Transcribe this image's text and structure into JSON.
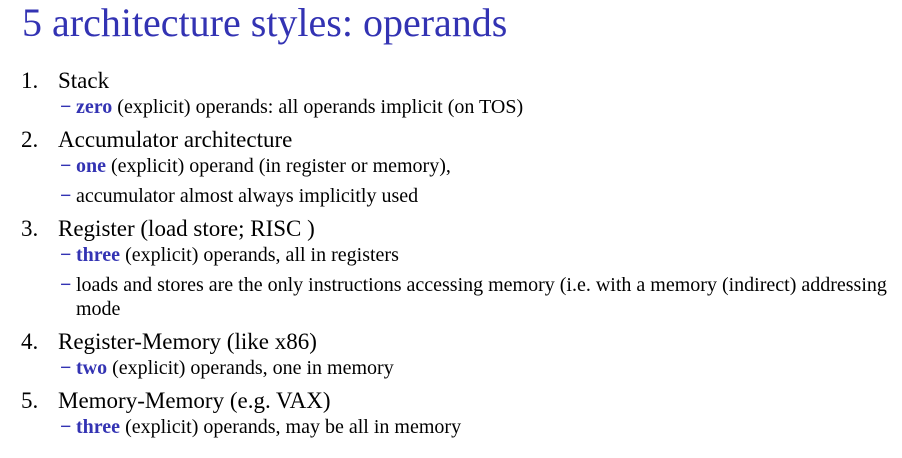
{
  "slide": {
    "title": "5 architecture styles: operands",
    "accent_color": "#3333b3",
    "dash_glyph": "−",
    "items": [
      {
        "number": "1.",
        "heading": "Stack",
        "subs": [
          {
            "keyword": "zero",
            "text": " (explicit) operands: all operands implicit (on TOS)"
          }
        ]
      },
      {
        "number": "2.",
        "heading": "Accumulator architecture",
        "subs": [
          {
            "keyword": "one",
            "text": " (explicit) operand (in register or memory),"
          },
          {
            "keyword": "",
            "text": "accumulator almost always implicitly used"
          }
        ]
      },
      {
        "number": "3.",
        "heading": "Register (load store; RISC )",
        "subs": [
          {
            "keyword": "three",
            "text": " (explicit) operands, all in registers"
          },
          {
            "keyword": "",
            "text": "loads and stores are the only instructions accessing memory (i.e. with a memory (indirect) addressing mode"
          }
        ]
      },
      {
        "number": "4.",
        "heading": "Register-Memory (like x86)",
        "subs": [
          {
            "keyword": "two",
            "text": " (explicit) operands, one in memory"
          }
        ]
      },
      {
        "number": "5.",
        "heading": "Memory-Memory (e.g. VAX)",
        "subs": [
          {
            "keyword": "three",
            "text": " (explicit) operands, may be all in memory"
          }
        ]
      }
    ]
  }
}
